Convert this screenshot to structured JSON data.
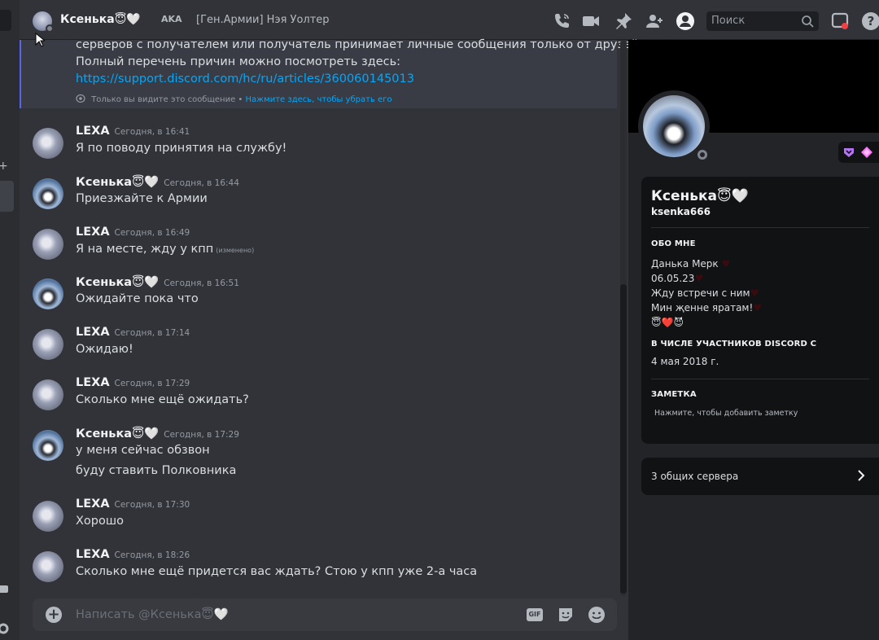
{
  "topbar": {
    "title": "Ксенька😇🤍",
    "aka_label": "AKA",
    "aka_value": "[Ген.Армии] Нэя Уолтер",
    "search_placeholder": "Поиск"
  },
  "system_message": {
    "line1": "серверов с получателем или получатель принимает личные сообщения только от друзей.",
    "line2": "Полный перечень причин можно посмотреть здесь:",
    "link": "https://support.discord.com/hc/ru/articles/360060145013",
    "note": "Только вы видите это сообщение •",
    "dismiss": "Нажмите здесь, чтобы убрать его"
  },
  "messages": [
    {
      "author": "LEXA",
      "time": "Сегодня, в 16:41",
      "text": "Я по поводу принятия на службу!"
    },
    {
      "author": "Ксенька😇🤍",
      "time": "Сегодня, в 16:44",
      "text": "Приезжайте к Армии"
    },
    {
      "author": "LEXA",
      "time": "Сегодня, в 16:49",
      "text": "Я на месте, жду у кпп",
      "edited": "(изменено)"
    },
    {
      "author": "Ксенька😇🤍",
      "time": "Сегодня, в 16:51",
      "text": "Ожидайте пока что"
    },
    {
      "author": "LEXA",
      "time": "Сегодня, в 17:14",
      "text": "Ожидаю!"
    },
    {
      "author": "LEXA",
      "time": "Сегодня, в 17:29",
      "text": "Сколько мне ещё ожидать?"
    },
    {
      "author": "Ксенька😇🤍",
      "time": "Сегодня, в 17:29",
      "text": "у меня сейчас обзвон",
      "text2": "буду ставить Полковника"
    },
    {
      "author": "LEXA",
      "time": "Сегодня, в 17:30",
      "text": "Хорошо"
    },
    {
      "author": "LEXA",
      "time": "Сегодня, в 18:26",
      "text": "Сколько мне ещё придется вас ждать? Стою у кпп уже 2-а часа"
    }
  ],
  "composer": {
    "placeholder": "Написать @Ксенька😇🤍",
    "gif_label": "GIF"
  },
  "profile": {
    "display_name": "Ксенька😇🤍",
    "username": "ksenka666",
    "about_heading": "ОБО МНЕ",
    "about_lines": [
      "Данька Мерк",
      "06.05.23",
      "Жду встречи с ним",
      "Мин җенне яратам!",
      "😇❤️😈"
    ],
    "member_since_heading": "В ЧИСЛЕ УЧАСТНИКОВ DISCORD С",
    "member_since": "4 мая 2018 г.",
    "note_heading": "ЗАМЕТКА",
    "note_placeholder": "Нажмите, чтобы добавить заметку",
    "mutual_servers": "3 общих сервера"
  },
  "colors": {
    "accent": "#5865f2",
    "link": "#00a8fc",
    "background": "#313338",
    "panel": "#232428",
    "card": "#111214"
  }
}
